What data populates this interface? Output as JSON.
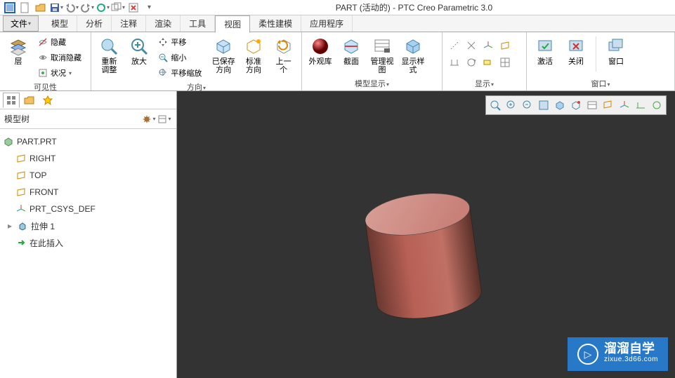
{
  "title": "PART (活动的) - PTC Creo Parametric 3.0",
  "menu": {
    "file": "文件"
  },
  "tabs": [
    "模型",
    "分析",
    "注释",
    "渲染",
    "工具",
    "视图",
    "柔性建模",
    "应用程序"
  ],
  "activeTab": 5,
  "ribbon": {
    "visibility": {
      "label": "可见性",
      "layers": "层",
      "hide": "隐藏",
      "unhide": "取消隐藏",
      "status": "状况"
    },
    "orient": {
      "label": "方向",
      "refit": "重新\n调整",
      "zoomin": "放大",
      "pan": "平移",
      "zoomout": "缩小",
      "panzoom": "平移缩放",
      "saved": "已保存\n方向",
      "std": "标准\n方向",
      "prev": "上一\n个"
    },
    "mdisp": {
      "label": "模型显示",
      "appearance": "外观库",
      "section": "截面",
      "mgview": "管理视图",
      "dispstyle": "显示样\n式"
    },
    "disp": {
      "label": "显示"
    },
    "window": {
      "label": "窗口",
      "activate": "激活",
      "close": "关闭",
      "win": "窗口"
    }
  },
  "sidebar": {
    "treeLabel": "模型树",
    "root": "PART.PRT",
    "items": [
      {
        "icon": "plane",
        "label": "RIGHT"
      },
      {
        "icon": "plane",
        "label": "TOP"
      },
      {
        "icon": "plane",
        "label": "FRONT"
      },
      {
        "icon": "csys",
        "label": "PRT_CSYS_DEF"
      },
      {
        "icon": "extrude",
        "label": "拉伸 1",
        "exp": true
      },
      {
        "icon": "insert",
        "label": "在此插入"
      }
    ]
  },
  "watermark": {
    "main": "溜溜自学",
    "sub": "zixue.3d66.com"
  },
  "chart_data": {
    "type": "3d-solid",
    "shape": "cylinder",
    "color": "#b86055",
    "notes": "slightly tilted red-brown cylinder in center of dark viewport"
  }
}
